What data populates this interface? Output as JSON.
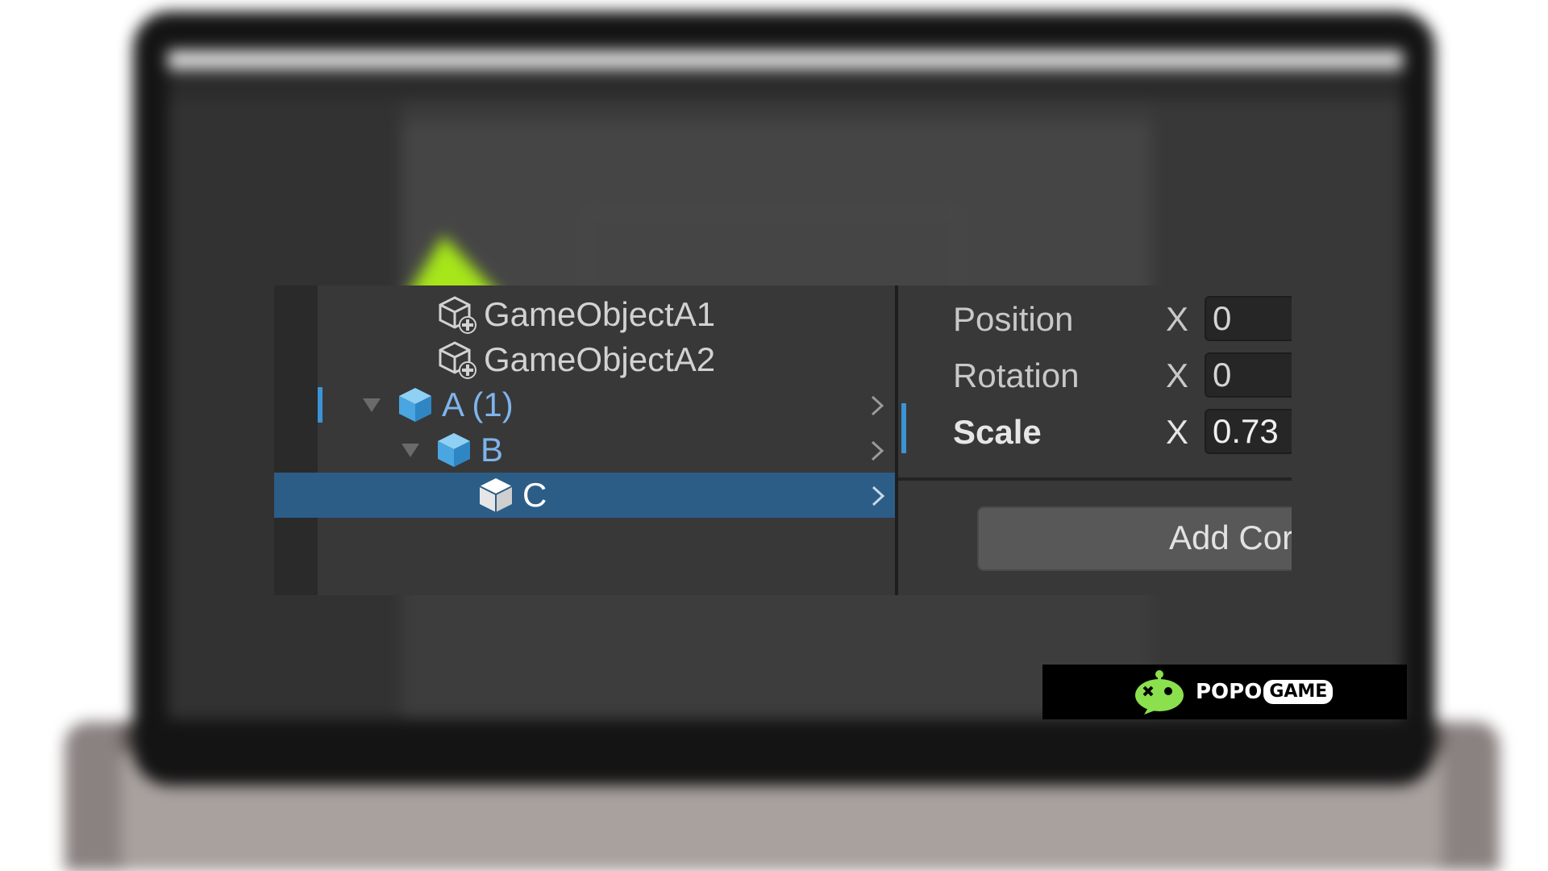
{
  "hierarchy": {
    "items": [
      {
        "label": "GameObjectA1",
        "icon": "prefab-add-icon",
        "depth": 0,
        "expandable": false,
        "selected": false
      },
      {
        "label": "GameObjectA2",
        "icon": "prefab-add-icon",
        "depth": 0,
        "expandable": false,
        "selected": false
      },
      {
        "label": "A (1)",
        "icon": "prefab-cube-icon",
        "depth": 0,
        "expandable": true,
        "selected": false
      },
      {
        "label": "B",
        "icon": "prefab-cube-icon",
        "depth": 1,
        "expandable": true,
        "selected": false
      },
      {
        "label": "C",
        "icon": "cube-icon",
        "depth": 2,
        "expandable": false,
        "selected": true
      }
    ]
  },
  "inspector": {
    "transform": [
      {
        "label": "Position",
        "axis": "X",
        "value": "0"
      },
      {
        "label": "Rotation",
        "axis": "X",
        "value": "0"
      },
      {
        "label": "Scale",
        "axis": "X",
        "value": "0.73"
      }
    ],
    "add_component_label": "Add Cor"
  },
  "logo": {
    "word1": "POPO",
    "word2": "GAME"
  },
  "colors": {
    "selection": "#2c5d87",
    "prefab_blue": "#7fb4ec",
    "accent_marker": "#3c93d6",
    "arrow_green": "#a6e61a"
  }
}
